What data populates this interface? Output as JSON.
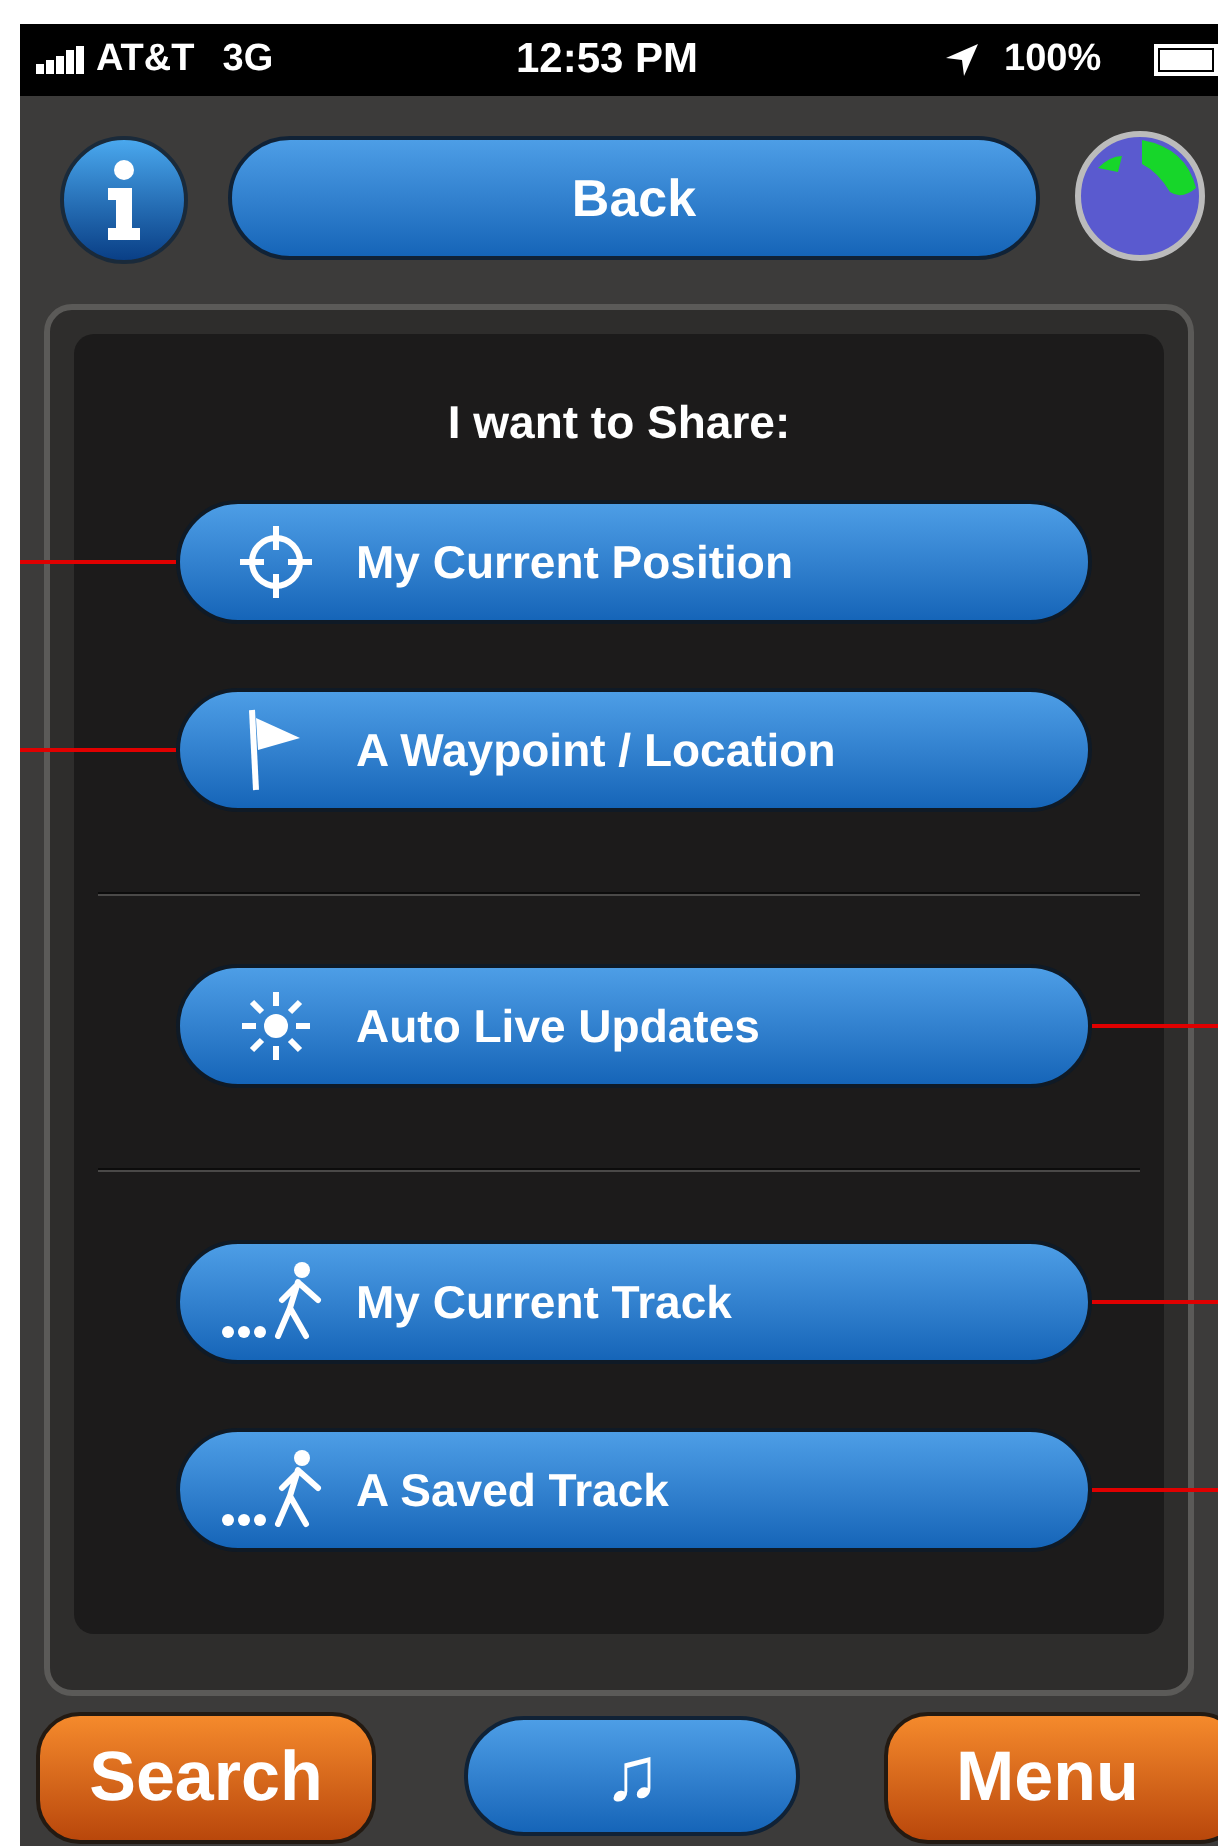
{
  "status_bar": {
    "carrier": "AT&T",
    "network": "3G",
    "time": "12:53 PM",
    "battery": "100%"
  },
  "top_bar": {
    "back_button": "Back"
  },
  "share_panel": {
    "heading": "I want to Share:",
    "groups": [
      {
        "buttons": [
          {
            "label": "My Current Position",
            "kind": "position"
          },
          {
            "label": "A Waypoint / Location",
            "kind": "waypoint"
          }
        ]
      },
      {
        "buttons": [
          {
            "label": "Auto Live Updates",
            "kind": "live"
          }
        ]
      },
      {
        "buttons": [
          {
            "label": "My Current Track",
            "kind": "track"
          },
          {
            "label": "A Saved Track",
            "kind": "track"
          }
        ]
      }
    ]
  },
  "bottom_bar": {
    "search_button": "Search",
    "music_button": "♫",
    "menu_button": "Menu"
  }
}
